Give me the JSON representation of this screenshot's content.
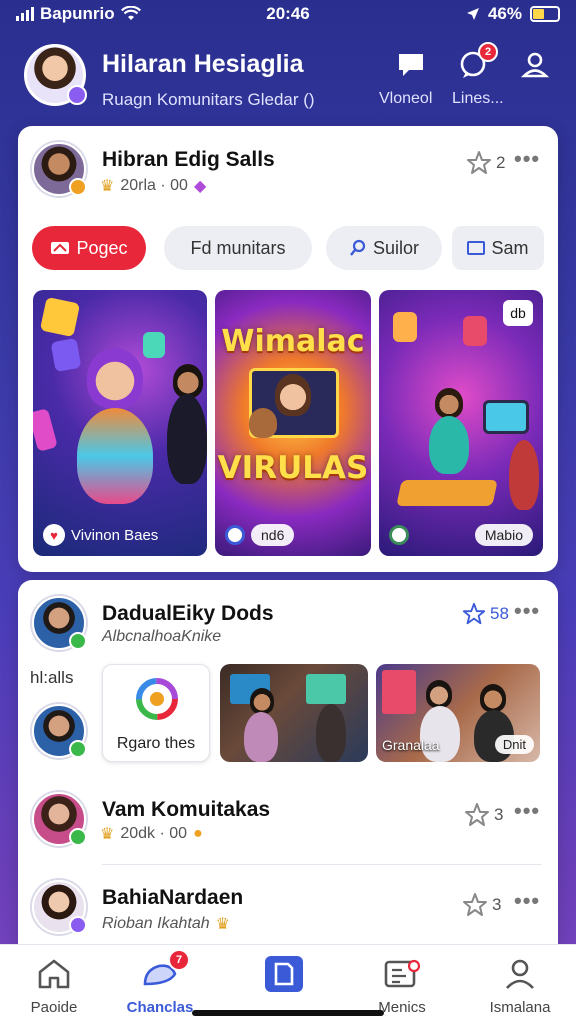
{
  "status_bar": {
    "carrier": "Bapunrio",
    "time": "20:46",
    "battery": "46%",
    "battery_level": 0.46
  },
  "header": {
    "title": "Hilaran Hesiaglia",
    "subtitle": "Ruagn Komunitars Gledar ()",
    "actions": [
      {
        "icon": "chat-icon",
        "label": "Vloneol"
      },
      {
        "icon": "comment-icon",
        "label": "Lines...",
        "badge": "2"
      },
      {
        "icon": "profile-icon",
        "label": ""
      }
    ]
  },
  "post1": {
    "name": "Hibran Edig Salls",
    "meta": "20rla · 00",
    "stars": "2",
    "chips": [
      {
        "label": "Pogec",
        "active": true
      },
      {
        "label": "Fd munitars",
        "active": false
      },
      {
        "label": "Suilor",
        "active": false
      },
      {
        "label": "Sam",
        "active": false
      }
    ],
    "tiles": [
      {
        "caption": "Vivinon Baes"
      },
      {
        "headline_top": "Wimalac",
        "headline_bottom": "VIRULAS",
        "caption": "nd6"
      },
      {
        "corner": "db",
        "caption": "Mabio"
      }
    ]
  },
  "post2": {
    "name": "DadualEiky Dods",
    "meta": "AlbcnalhoaKnike",
    "stars": "58",
    "side_label": "hl:alls",
    "media": [
      {
        "caption": "Rgaro thes"
      },
      {
        "caption": ""
      },
      {
        "caption": "Granalaa",
        "tag": "Dnit"
      }
    ]
  },
  "post3": {
    "name": "Vam Komuitakas",
    "meta": "20dk · 00",
    "stars": "3"
  },
  "post4": {
    "name": "BahiaNardaen",
    "meta": "Rioban Ikahtah",
    "stars": "3"
  },
  "bottom_nav": [
    {
      "label": "Paoide",
      "icon": "home-icon",
      "active": false
    },
    {
      "label": "Chanclas",
      "icon": "community-icon",
      "active": true,
      "badge": "7"
    },
    {
      "label": "",
      "icon": "bookmark-icon",
      "active": false
    },
    {
      "label": "Menics",
      "icon": "media-icon",
      "active": false
    },
    {
      "label": "Ismalana",
      "icon": "profile-icon",
      "active": false
    }
  ],
  "colors": {
    "accent": "#e8283a",
    "active_nav": "#3a5ad8",
    "background": "#3a3aa6"
  }
}
